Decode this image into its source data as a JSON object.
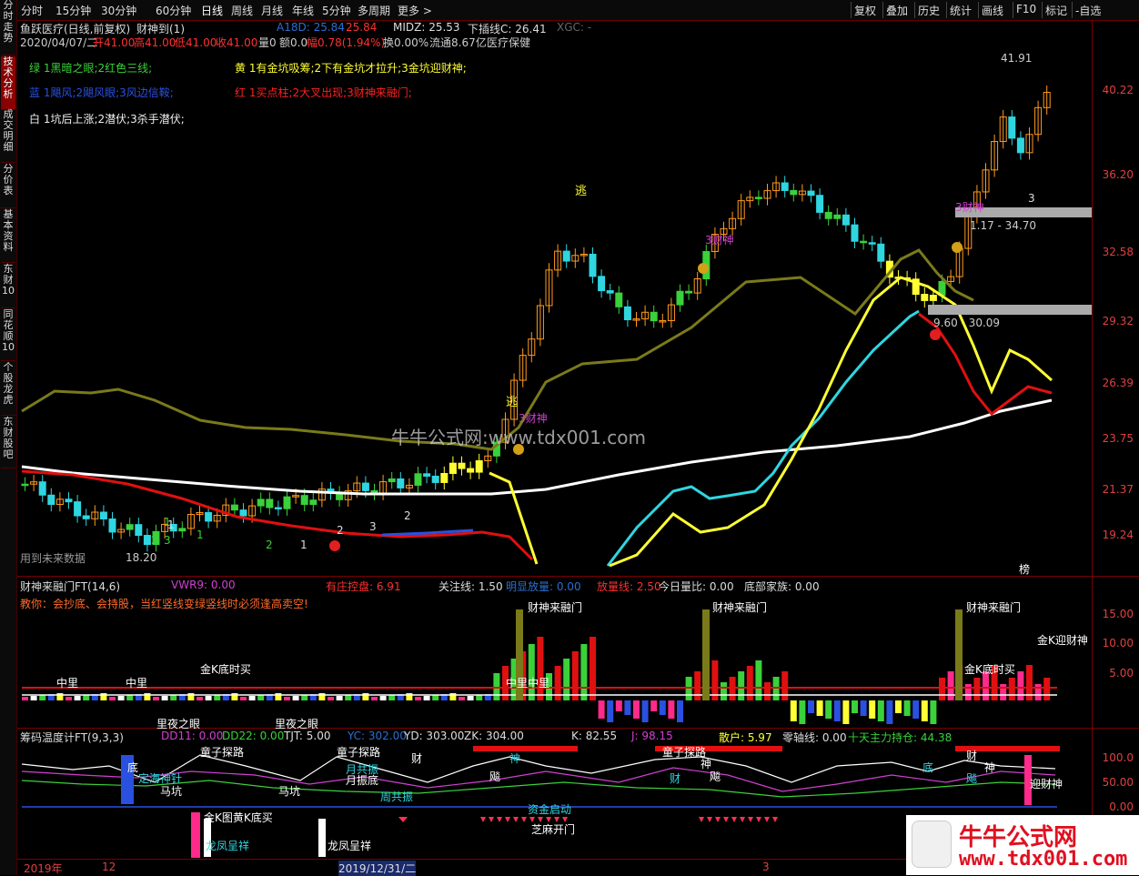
{
  "toolbar": {
    "periods": [
      "分时",
      "15分钟",
      "30分钟",
      "60分钟",
      "日线",
      "周线",
      "月线",
      "年线",
      "5分钟",
      "多周期",
      "更多 >"
    ],
    "active_period": "日线",
    "tools": [
      "复权",
      "叠加",
      "历史",
      "统计",
      "画线",
      "F10",
      "标记",
      "-自选"
    ]
  },
  "sidebar": {
    "tabs": [
      "分时走势",
      "技术分析",
      "成交明细",
      "分价表",
      "基本资料",
      "东财10",
      "同花顺10",
      "个股龙虎",
      "东财股吧"
    ],
    "active": "技术分析"
  },
  "header": {
    "stock": "鱼跃医疗(日线,前复权)",
    "indicator": "财神到(1)",
    "a18d": "A18D: 25.84",
    "v2": "25.84",
    "midz": "MIDZ: 25.53",
    "xcx": "下插线C: 26.41",
    "xgc": "XGC: -",
    "date": "2020/04/07/二",
    "open": "开41.00",
    "high": "高41.00",
    "low": "低41.00",
    "close": "收41.00",
    "vol": "量0",
    "amt": "额0.0",
    "chg": "幅0.78(1.94%)",
    "turnover": "换0.00%",
    "float": "流通8.67亿",
    "sector": "医疗保健"
  },
  "legend": {
    "green": "绿 1黑暗之眼;2红色三线;",
    "yellow": "黄 1有金坑吸筹;2下有金坑才拉升;3金坑迎财神;",
    "blue": "蓝 1飓风;2飓风眼;3风边信鞍;",
    "red": "红 1买点柱;2大叉出现;3财神来融门;",
    "white": "白 1坑后上涨;2潜伏;3杀手潜伏;"
  },
  "main_axis": [
    "40.22",
    "36.20",
    "32.58",
    "29.32",
    "26.39",
    "23.75",
    "21.37",
    "19.24"
  ],
  "main_annotations": {
    "high": "41.91",
    "low": "18.20",
    "zone1": "1.17 - 34.70",
    "zone2": "9.60 - 30.09",
    "escape1": "逃",
    "escape2": "逃",
    "cs1": "3财神",
    "cs2": "3财神",
    "cs3": "3财神",
    "watermark": "牛牛公式网:www.tdx001.com",
    "future": "用到未来数据",
    "bang": "榜",
    "nums": [
      "1",
      "2",
      "3",
      "1",
      "2",
      "1",
      "2",
      "3",
      "2",
      "1",
      "3"
    ]
  },
  "panel2": {
    "title": "财神来融门FT(14,6)",
    "vwr": "VWR9: 0.00",
    "youzhuang": "有庄控盘: 6.91",
    "guanzhu": "关注线: 1.50",
    "mingxian": "明显放量: 0.00",
    "fangliang": "放量线: 2.50",
    "jinri": "今日量比: 0.00",
    "dibu": "底部家族: 0.00",
    "tip": "教你：会抄底、会持股，当红竖线变绿竖线时必须逢高卖空!",
    "axis": [
      "15.00",
      "10.00",
      "5.00"
    ],
    "tags": [
      "财神来融门",
      "财神来融门",
      "财神来融门",
      "金K迎财神",
      "金K底时买",
      "金K底时买",
      "中里",
      "中里",
      "中里",
      "中里",
      "里夜之眼",
      "里夜之眼"
    ]
  },
  "panel3": {
    "title": "筹码温度计FT(9,3,3)",
    "dd11": "DD11: 0.00",
    "dd22": "DD22: 0.00",
    "tjt": "TJT: 5.00",
    "yc": "YC: 302.00",
    "yd": "YD: 303.00",
    "zk": "ZK: 304.00",
    "k": "K: 82.55",
    "j": "J: 98.15",
    "sanhu": "散户: 5.97",
    "lingzhou": "零轴线: 0.00",
    "shitian": "十天主力持仓: 44.38",
    "axis": [
      "100.0",
      "50.00",
      "0.00"
    ],
    "tags": [
      "底",
      "定海神针",
      "马坑",
      "童子探路",
      "月共振",
      "月振底",
      "马坑",
      "周共振",
      "童子探路",
      "财",
      "神",
      "飚",
      "童子探路",
      "财",
      "飚",
      "神",
      "底",
      "财",
      "神",
      "飚",
      "迎财神",
      "金K图黄K底买",
      "龙凤呈祥",
      "龙凤呈祥",
      "芝麻开门",
      "资金启动"
    ]
  },
  "date_axis": [
    "2019年",
    "12",
    "2019/12/31/二",
    "3"
  ],
  "logo": {
    "text": "牛牛公式网",
    "url": "www.tdx001.com"
  },
  "colors": {
    "up": "#ff9a1f",
    "down": "#2fd6e0",
    "green": "#3ad13a",
    "ma_white": "#ffffff",
    "ma_olive": "#7a7a1a",
    "red_line": "#e01010",
    "yellow_line": "#ffff33"
  },
  "chart_data": {
    "type": "candlestick",
    "title": "",
    "ylim": [
      18,
      43
    ],
    "high": 41.91,
    "low": 18.2
  }
}
